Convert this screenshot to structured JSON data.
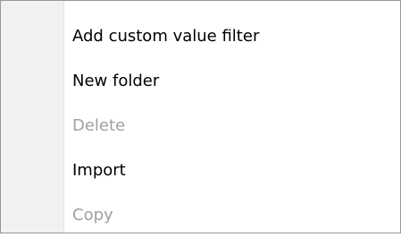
{
  "menu": {
    "items": [
      {
        "label": "Add custom value filter",
        "enabled": true
      },
      {
        "label": "New folder",
        "enabled": true
      },
      {
        "label": "Delete",
        "enabled": false
      },
      {
        "label": "Import",
        "enabled": true
      },
      {
        "label": "Copy",
        "enabled": false
      }
    ]
  },
  "colors": {
    "text": "#000000",
    "disabled_text": "#a0a0a0",
    "gutter": "#f1f1f1",
    "border": "#979797",
    "background": "#ffffff"
  }
}
